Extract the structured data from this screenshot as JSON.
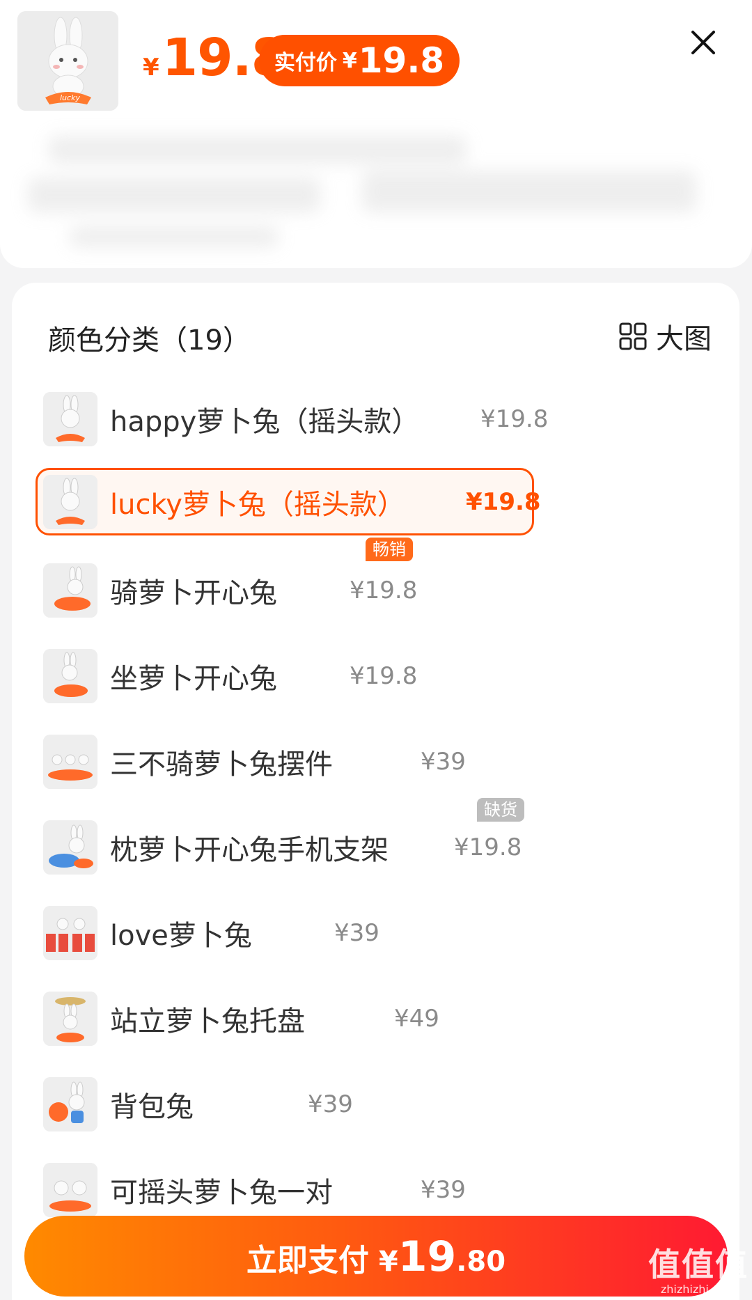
{
  "header": {
    "price_currency": "¥",
    "price": "19.8",
    "pay_label": "实付价",
    "pay_currency": "¥",
    "pay_price": "19.8",
    "close_icon": "close-icon",
    "accent_color": "#ff5000"
  },
  "options": {
    "title": "颜色分类（19）",
    "view_large": "大图",
    "view_icon": "grid-icon",
    "items": [
      {
        "name": "happy萝卜兔（摇头款）",
        "price": "¥19.8"
      },
      {
        "name": "lucky萝卜兔（摇头款）",
        "price": "¥19.8",
        "selected": true,
        "badge": "畅销"
      },
      {
        "name": "骑萝卜开心兔",
        "price": "¥19.8"
      },
      {
        "name": "坐萝卜开心兔",
        "price": "¥19.8"
      },
      {
        "name": "三不骑萝卜兔摆件",
        "price": "¥39",
        "badge": "缺货"
      },
      {
        "name": "枕萝卜开心兔手机支架",
        "price": "¥19.8"
      },
      {
        "name": "love萝卜兔",
        "price": "¥39"
      },
      {
        "name": "站立萝卜兔托盘",
        "price": "¥49"
      },
      {
        "name": "背包兔",
        "price": "¥39"
      },
      {
        "name": "可摇头萝卜兔一对",
        "price": "¥39"
      }
    ]
  },
  "pay_button": {
    "label": "立即支付",
    "currency": "¥",
    "integer": "19",
    "decimal": ".80"
  },
  "watermark": {
    "big": "值值值",
    "small": "zhizhizhi.com"
  }
}
